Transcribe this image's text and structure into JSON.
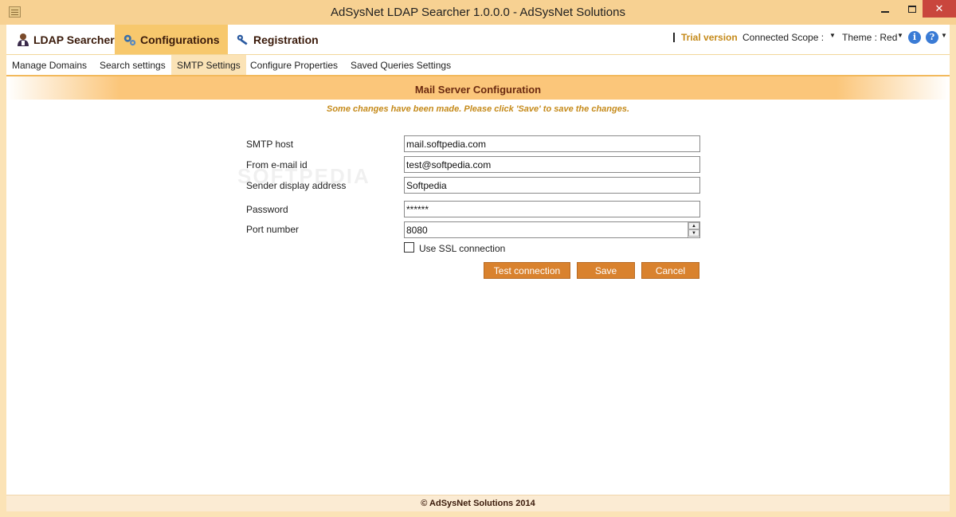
{
  "window": {
    "title": "AdSysNet LDAP Searcher 1.0.0.0 - AdSysNet Solutions",
    "minimize_icon": "minimize-icon",
    "maximize_icon": "maximize-icon",
    "close_glyph": "✕"
  },
  "main_tabs": [
    {
      "label": "LDAP Searcher",
      "icon": "user-icon"
    },
    {
      "label": "Configurations",
      "icon": "gears-icon"
    },
    {
      "label": "Registration",
      "icon": "key-icon"
    }
  ],
  "toolbar": {
    "separator": "I",
    "trial_label": "Trial version",
    "scope_label": "Connected Scope :",
    "theme_label": "Theme : Red",
    "dropdown_glyph": "▼",
    "info_glyph": "i",
    "help_glyph": "?"
  },
  "sub_tabs": [
    {
      "label": "Manage Domains"
    },
    {
      "label": "Search settings"
    },
    {
      "label": "SMTP Settings",
      "active": true
    },
    {
      "label": "Configure Properties"
    },
    {
      "label": "Saved Queries Settings"
    }
  ],
  "panel": {
    "title": "Mail Server Configuration",
    "notice": "Some changes have been made. Please click 'Save' to save the changes."
  },
  "form": {
    "smtp_host": {
      "label": "SMTP host",
      "value": "mail.softpedia.com"
    },
    "from_email": {
      "label": "From e-mail id",
      "value": "test@softpedia.com"
    },
    "sender_display": {
      "label": "Sender display address",
      "value": "Softpedia"
    },
    "password": {
      "label": "Password",
      "value": "******"
    },
    "port": {
      "label": "Port number",
      "value": "8080"
    },
    "ssl": {
      "label": "Use SSL connection",
      "checked": false
    }
  },
  "buttons": {
    "test": "Test connection",
    "save": "Save",
    "cancel": "Cancel"
  },
  "watermark": "SOFTPEDIA",
  "footer": "© AdSysNet Solutions 2014",
  "colors": {
    "accent": "#d9822e",
    "title_bar": "#f7d192",
    "trial": "#c58a1a",
    "section_title": "#6b2a10"
  }
}
